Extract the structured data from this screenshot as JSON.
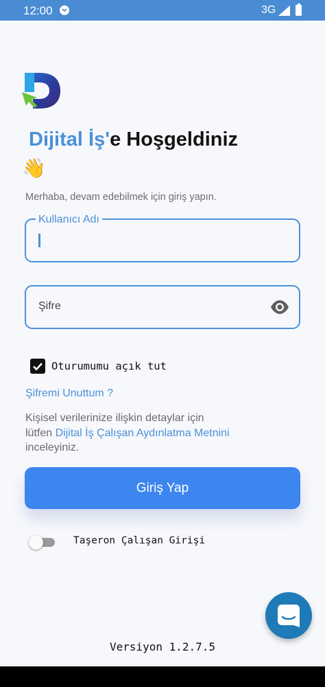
{
  "status_bar": {
    "time": "12:00",
    "network": "3G",
    "icons": [
      "notification-icon",
      "signal-icon",
      "battery-icon"
    ],
    "color": "#4a8cd4"
  },
  "welcome": {
    "brand": "Dijital İş'",
    "rest": "e Hoşgeldiniz",
    "emoji": "👋"
  },
  "subtitle": "Merhaba, devam edebilmek için giriş yapın.",
  "username_field": {
    "label": "Kullanıcı Adı",
    "value": ""
  },
  "password_field": {
    "placeholder": "Şifre",
    "icon": "eye-icon"
  },
  "remember_me": {
    "label": "Oturumumu açık tut",
    "checked": true
  },
  "forgot_password": "Şifremi Unuttum ?",
  "privacy": {
    "line1": "Kişisel verilerinize ilişkin detaylar için",
    "prefix": "lütfen ",
    "link": "Dijital İş Çalışan Aydınlatma Metnini",
    "suffix": "inceleyiniz."
  },
  "login_button": "Giriş Yap",
  "subcontractor_toggle": {
    "label": "Taşeron Çalışan Girişi",
    "on": false
  },
  "chat_button": {
    "icon": "chat-icon"
  },
  "version": "Versiyon 1.2.7.5",
  "colors": {
    "accent": "#4a90d9",
    "button": "#3d86f0",
    "chat": "#1f7ab8"
  }
}
